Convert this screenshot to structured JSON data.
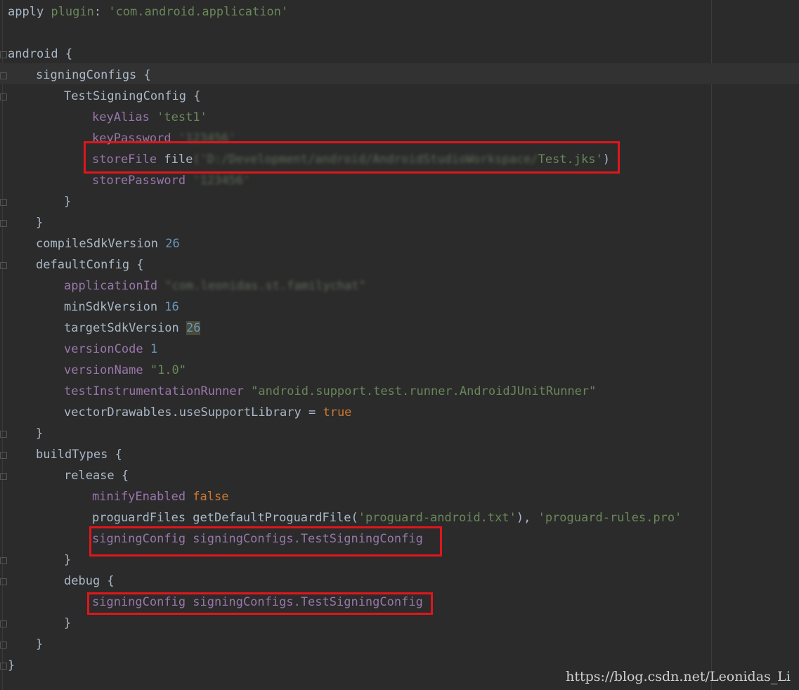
{
  "code_lines": [
    {
      "indent": 0,
      "tokens": [
        {
          "t": "apply ",
          "c": "plain"
        },
        {
          "t": "plugin",
          "c": "str"
        },
        {
          "t": ": ",
          "c": "plain"
        },
        {
          "t": "'com.android.application'",
          "c": "str"
        }
      ]
    },
    {
      "indent": 0,
      "tokens": []
    },
    {
      "indent": 0,
      "tokens": [
        {
          "t": "android {",
          "c": "plain"
        }
      ]
    },
    {
      "indent": 1,
      "tokens": [
        {
          "t": "signingConfigs {",
          "c": "plain"
        }
      ]
    },
    {
      "indent": 2,
      "tokens": [
        {
          "t": "TestSigningConfig {",
          "c": "plain"
        }
      ]
    },
    {
      "indent": 3,
      "tokens": [
        {
          "t": "keyAlias ",
          "c": "prop"
        },
        {
          "t": "'test1'",
          "c": "str"
        }
      ]
    },
    {
      "indent": 3,
      "tokens": [
        {
          "t": "keyPassword ",
          "c": "prop"
        },
        {
          "t": "'123456'",
          "c": "blur"
        }
      ]
    },
    {
      "indent": 3,
      "tokens": [
        {
          "t": "storeFile ",
          "c": "prop"
        },
        {
          "t": "file",
          "c": "plain"
        },
        {
          "t": "('D:/Development/android/AndroidStudioWorkspace/",
          "c": "blur"
        },
        {
          "t": "Test.jks'",
          "c": "str"
        },
        {
          "t": ")",
          "c": "plain"
        }
      ]
    },
    {
      "indent": 3,
      "tokens": [
        {
          "t": "storePassword ",
          "c": "prop"
        },
        {
          "t": "'123456'",
          "c": "blur"
        }
      ]
    },
    {
      "indent": 2,
      "tokens": [
        {
          "t": "}",
          "c": "plain"
        }
      ]
    },
    {
      "indent": 1,
      "tokens": [
        {
          "t": "}",
          "c": "plain"
        }
      ]
    },
    {
      "indent": 1,
      "tokens": [
        {
          "t": "compileSdkVersion ",
          "c": "plain"
        },
        {
          "t": "26",
          "c": "num"
        }
      ]
    },
    {
      "indent": 1,
      "tokens": [
        {
          "t": "defaultConfig {",
          "c": "plain"
        }
      ]
    },
    {
      "indent": 2,
      "tokens": [
        {
          "t": "applicationId ",
          "c": "prop"
        },
        {
          "t": "\"com.leonidas.st.familychat\"",
          "c": "blur"
        }
      ]
    },
    {
      "indent": 2,
      "tokens": [
        {
          "t": "minSdkVersion ",
          "c": "plain"
        },
        {
          "t": "16",
          "c": "num"
        }
      ]
    },
    {
      "indent": 2,
      "tokens": [
        {
          "t": "targetSdkVersion ",
          "c": "plain"
        },
        {
          "t": "26",
          "c": "num",
          "hl": true
        }
      ]
    },
    {
      "indent": 2,
      "tokens": [
        {
          "t": "versionCode ",
          "c": "prop"
        },
        {
          "t": "1",
          "c": "num"
        }
      ]
    },
    {
      "indent": 2,
      "tokens": [
        {
          "t": "versionName ",
          "c": "prop"
        },
        {
          "t": "\"1.0\"",
          "c": "str"
        }
      ]
    },
    {
      "indent": 2,
      "tokens": [
        {
          "t": "testInstrumentationRunner ",
          "c": "prop"
        },
        {
          "t": "\"android.support.test.runner.AndroidJUnitRunner\"",
          "c": "str"
        }
      ]
    },
    {
      "indent": 2,
      "tokens": [
        {
          "t": "vectorDrawables.useSupportLibrary = ",
          "c": "plain"
        },
        {
          "t": "true",
          "c": "kw"
        }
      ]
    },
    {
      "indent": 1,
      "tokens": [
        {
          "t": "}",
          "c": "plain"
        }
      ]
    },
    {
      "indent": 1,
      "tokens": [
        {
          "t": "buildTypes {",
          "c": "plain"
        }
      ]
    },
    {
      "indent": 2,
      "tokens": [
        {
          "t": "release {",
          "c": "plain"
        }
      ]
    },
    {
      "indent": 3,
      "tokens": [
        {
          "t": "minifyEnabled ",
          "c": "prop"
        },
        {
          "t": "false",
          "c": "kw"
        }
      ]
    },
    {
      "indent": 3,
      "tokens": [
        {
          "t": "proguardFiles getDefaultProguardFile(",
          "c": "plain"
        },
        {
          "t": "'proguard-android.txt'",
          "c": "str"
        },
        {
          "t": "), ",
          "c": "plain"
        },
        {
          "t": "'proguard-rules.pro'",
          "c": "str"
        }
      ]
    },
    {
      "indent": 3,
      "tokens": [
        {
          "t": "signingConfig ",
          "c": "prop"
        },
        {
          "t": "signingConfigs.TestSigningConfig",
          "c": "prop"
        }
      ]
    },
    {
      "indent": 2,
      "tokens": [
        {
          "t": "}",
          "c": "plain"
        }
      ]
    },
    {
      "indent": 2,
      "tokens": [
        {
          "t": "debug {",
          "c": "plain"
        }
      ]
    },
    {
      "indent": 3,
      "tokens": [
        {
          "t": "signingConfig ",
          "c": "prop"
        },
        {
          "t": "signingConfigs.TestSigningConfig",
          "c": "prop"
        }
      ]
    },
    {
      "indent": 2,
      "tokens": [
        {
          "t": "}",
          "c": "plain"
        }
      ]
    },
    {
      "indent": 1,
      "tokens": [
        {
          "t": "}",
          "c": "plain"
        }
      ]
    },
    {
      "indent": 0,
      "tokens": [
        {
          "t": "}",
          "c": "plain"
        }
      ]
    }
  ],
  "watermark": "https://blog.csdn.net/Leonidas_Li",
  "colors": {
    "background": "#2b2b2b",
    "keyword": "#cc7832",
    "string": "#6a8759",
    "number": "#6897bb",
    "property": "#9876aa",
    "plain": "#a9b7c6",
    "annotation_box": "#e0161b"
  }
}
